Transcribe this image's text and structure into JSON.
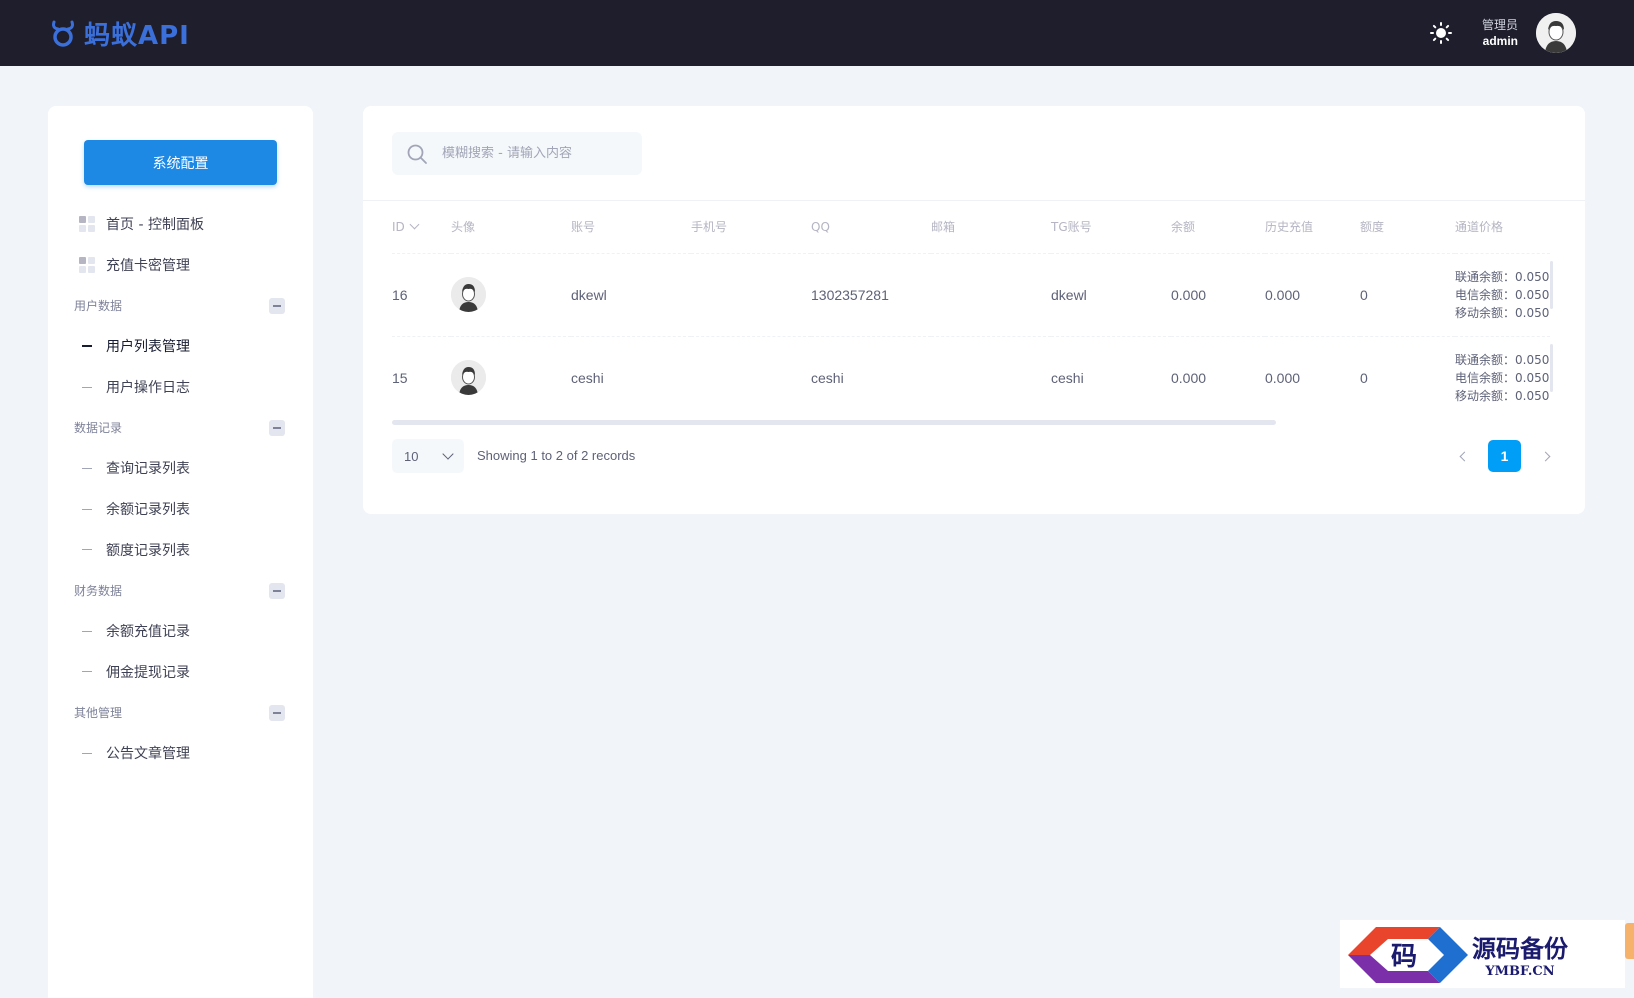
{
  "header": {
    "brand": "蚂蚁API",
    "user_role": "管理员",
    "user_name": "admin"
  },
  "sidebar": {
    "config_button": "系统配置",
    "top_items": [
      {
        "label": "首页 - 控制面板",
        "icon": "grid-icon"
      },
      {
        "label": "充值卡密管理",
        "icon": "grid-icon"
      }
    ],
    "sections": [
      {
        "title": "用户数据",
        "items": [
          "用户列表管理",
          "用户操作日志"
        ]
      },
      {
        "title": "数据记录",
        "items": [
          "查询记录列表",
          "余额记录列表",
          "额度记录列表"
        ]
      },
      {
        "title": "财务数据",
        "items": [
          "余额充值记录",
          "佣金提现记录"
        ]
      },
      {
        "title": "其他管理",
        "items": [
          "公告文章管理"
        ]
      }
    ],
    "active_item": "用户列表管理"
  },
  "search": {
    "placeholder": "模糊搜索 - 请输入内容"
  },
  "table": {
    "columns": [
      "ID",
      "头像",
      "账号",
      "手机号",
      "QQ",
      "邮箱",
      "TG账号",
      "余额",
      "历史充值",
      "额度",
      "通道价格"
    ],
    "rows": [
      {
        "id": "16",
        "account": "dkewl",
        "phone": "",
        "qq": "1302357281",
        "email": "",
        "tg": "dkewl",
        "balance": "0.000",
        "history": "0.000",
        "quota": "0",
        "prices": [
          "联通余额：0.050",
          "电信余额：0.050",
          "移动余额：0.050"
        ]
      },
      {
        "id": "15",
        "account": "ceshi",
        "phone": "",
        "qq": "ceshi",
        "email": "",
        "tg": "ceshi",
        "balance": "0.000",
        "history": "0.000",
        "quota": "0",
        "prices": [
          "联通余额：0.050",
          "电信余额：0.050",
          "移动余额：0.050"
        ]
      }
    ]
  },
  "footer": {
    "page_size": "10",
    "records_info": "Showing 1 to 2 of 2 records",
    "current_page": "1"
  },
  "watermark": {
    "badge_char": "码",
    "cn_text": "源码备份",
    "en_text": "YMBF.CN"
  },
  "colors": {
    "topbar": "#1e1e2d",
    "primary_button": "#1e88e5",
    "active_page": "#009ef7",
    "brand": "#3b6fd9"
  }
}
